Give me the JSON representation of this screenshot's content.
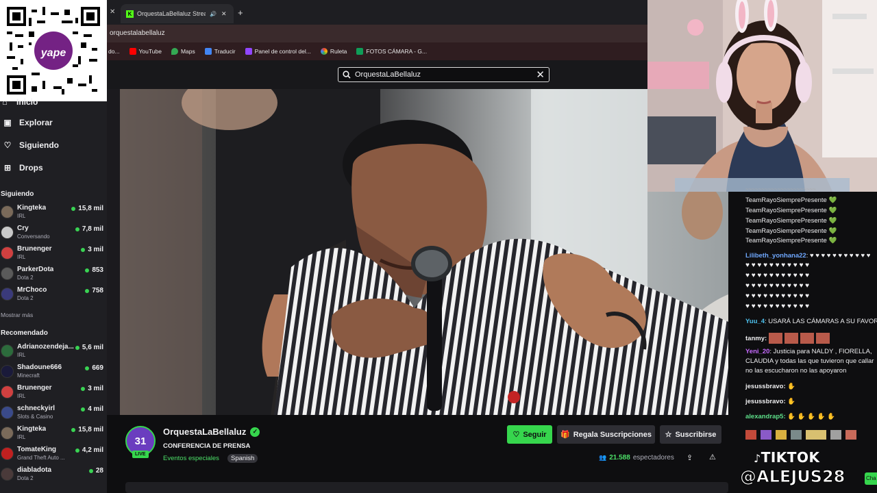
{
  "browser": {
    "tabs": [
      {
        "label": "OrquestaLaBellaluz Stream",
        "icon": "twitch-kick-icon"
      }
    ],
    "new_tab": "+",
    "url": "orquestalabellaluz",
    "bookmarks": [
      {
        "label": "YouTube",
        "color": "#ff0000"
      },
      {
        "label": "Maps",
        "color": "#34a853"
      },
      {
        "label": "Traducir",
        "color": "#4285f4"
      },
      {
        "label": "Panel de control del...",
        "color": "#9146ff"
      },
      {
        "label": "Ruleta",
        "color": "#fbbc05"
      },
      {
        "label": "FOTOS CÁMARA - G...",
        "color": "#0f9d58"
      }
    ]
  },
  "search": {
    "value": "OrquestaLaBellaluz"
  },
  "sidebar": {
    "nav": [
      {
        "label": "Inicio",
        "icon": "home-icon"
      },
      {
        "label": "Explorar",
        "icon": "browse-icon"
      },
      {
        "label": "Siguiendo",
        "icon": "heart-icon"
      },
      {
        "label": "Drops",
        "icon": "drops-icon"
      }
    ],
    "following_title": "Siguiendo",
    "following": [
      {
        "name": "Kingteka",
        "game": "IRL",
        "viewers": "15,8 mil",
        "color": "#7a6a5a"
      },
      {
        "name": "Cry",
        "game": "Conversando",
        "viewers": "7,8 mil",
        "color": "#c9c9c9"
      },
      {
        "name": "Brunenger",
        "game": "IRL",
        "viewers": "3 mil",
        "color": "#d04040"
      },
      {
        "name": "ParkerDota",
        "game": "Dota 2",
        "viewers": "853",
        "color": "#5a5a5a"
      },
      {
        "name": "MrChoco",
        "game": "Dota 2",
        "viewers": "758",
        "color": "#3a3a7a"
      }
    ],
    "show_more": "Mostrar más",
    "recommended_title": "Recomendado",
    "recommended": [
      {
        "name": "Adrianozendeja...",
        "game": "IRL",
        "viewers": "5,6 mil",
        "color": "#2c6b3c"
      },
      {
        "name": "Shadoune666",
        "game": "Minecraft",
        "viewers": "669",
        "color": "#1a1a3a"
      },
      {
        "name": "Brunenger",
        "game": "IRL",
        "viewers": "3 mil",
        "color": "#d04040"
      },
      {
        "name": "schneckyirl",
        "game": "Slots & Casino",
        "viewers": "4 mil",
        "color": "#3a4a8a"
      },
      {
        "name": "Kingteka",
        "game": "IRL",
        "viewers": "15,8 mil",
        "color": "#7a6a5a"
      },
      {
        "name": "TomateKing",
        "game": "Grand Theft Auto ...",
        "viewers": "4,2 mil",
        "color": "#c02020"
      },
      {
        "name": "diabladota",
        "game": "Dota 2",
        "viewers": "28",
        "color": "#4a3a3a"
      }
    ]
  },
  "stream": {
    "channel": "OrquestaLaBellaluz",
    "title": "CONFERENCIA DE PRENSA",
    "category": "Eventos especiales",
    "language": "Spanish",
    "avatar_text": "31",
    "live": "LIVE",
    "viewers": "21.588",
    "viewers_label": "espectadores",
    "follow": "Seguir",
    "gift": "Regala Suscripciones",
    "subscribe": "Suscribirse"
  },
  "chat": {
    "messages": [
      {
        "user": "",
        "text": "TeamRayoSiemprePresente",
        "heart": "💚"
      },
      {
        "user": "",
        "text": "TeamRayoSiemprePresente",
        "heart": "💚"
      },
      {
        "user": "",
        "text": "TeamRayoSiemprePresente",
        "heart": "💚"
      },
      {
        "user": "",
        "text": "TeamRayoSiemprePresente",
        "heart": "💚"
      },
      {
        "user": "",
        "text": "TeamRayoSiemprePresente",
        "heart": "💚"
      }
    ],
    "lilibeth_user": "Lilibeth_yonhana22",
    "hearts_row": "♥ ♥ ♥ ♥ ♥ ♥ ♥ ♥ ♥ ♥ ♥",
    "yuu_user": "Yuu_4",
    "yuu_text": "USARÁ LAS CÁMARAS A SU FAVOR",
    "tanmy_user": "tanmy:",
    "yeni_user": "Yeni_20",
    "yeni_text": "Justicia para NALDY , FIORELLA, CLAUDIA y todas las que tuvieron que callar no las escucharon no las apoyaron",
    "jesuss1": "jesussbravo:",
    "jesuss2": "jesussbravo:",
    "alexandra": "alexandrap5:",
    "user_colors": {
      "lilibeth": "#6fa8ff",
      "yuu": "#4ec3f0",
      "tanmy": "#efeff1",
      "yeni": "#c76bff"
    }
  },
  "overlay": {
    "tiktok": "TIKTOK",
    "handle": "@ALEJUS28",
    "chat_button": "Cha"
  }
}
